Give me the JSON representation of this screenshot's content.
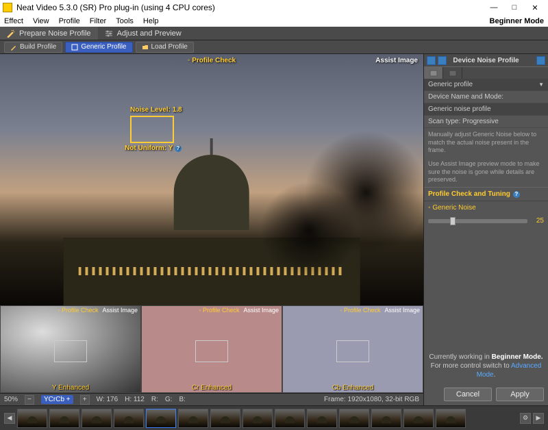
{
  "title": "Neat Video 5.3.0 (SR) Pro plug-in (using 4 CPU cores)",
  "window": {
    "minimize": "—",
    "maximize": "□",
    "close": "✕"
  },
  "menu": [
    "Effect",
    "View",
    "Profile",
    "Filter",
    "Tools",
    "Help"
  ],
  "mode_label": "Beginner Mode",
  "tabs": {
    "prepare": "Prepare Noise Profile",
    "adjust": "Adjust and Preview"
  },
  "toolbar": {
    "build": "Build Profile",
    "generic": "Generic Profile",
    "load": "Load Profile"
  },
  "main": {
    "profile_check": "◦ Profile Check",
    "assist_image": "Assist Image",
    "noise_level": "Noise Level: 1.8",
    "not_uniform": "Not Uniform: Y"
  },
  "tri": {
    "profile_check": "◦ Profile Check",
    "assist_image": "Assist Image",
    "y": "Y Enhanced",
    "cr": "Cr Enhanced",
    "cb": "Cb Enhanced"
  },
  "status": {
    "zoom": "50%",
    "space": "YCrCb +",
    "w": "W: 176",
    "h": "H: 112",
    "r": "R:",
    "g": "G:",
    "b": "B:",
    "frame": "Frame: 1920x1080, 32-bit RGB"
  },
  "panel": {
    "title": "Device Noise Profile",
    "dropdown": "Generic profile",
    "device_name_label": "Device Name and Mode:",
    "device_name": "Generic noise profile",
    "scan": "Scan type:  Progressive",
    "hint1": "Manually adjust Generic Noise below to match the actual noise present in the frame.",
    "hint2": "Use Assist Image preview mode to make sure the noise is gone while details are preserved.",
    "section": "Profile Check and Tuning",
    "slider_label": "◦ Generic Noise",
    "slider_value": "25"
  },
  "footer": {
    "hint_line1": "Currently working in ",
    "hint_bold": "Beginner Mode.",
    "hint_line2": "For more control switch to ",
    "hint_link": "Advanced Mode",
    "cancel": "Cancel",
    "apply": "Apply"
  }
}
